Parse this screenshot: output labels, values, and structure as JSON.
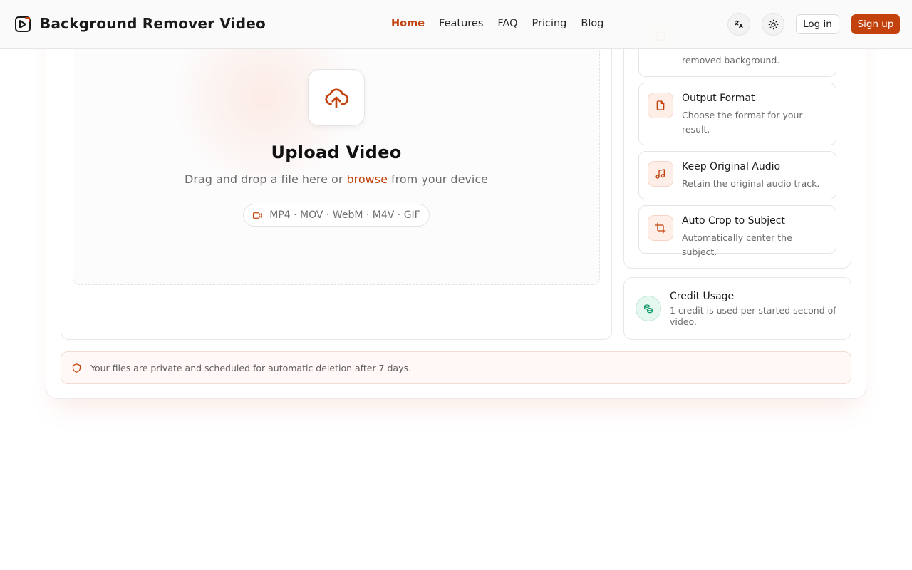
{
  "header": {
    "brand": "Background Remover Video",
    "nav": [
      {
        "label": "Home",
        "active": true
      },
      {
        "label": "Features"
      },
      {
        "label": "FAQ"
      },
      {
        "label": "Pricing"
      },
      {
        "label": "Blog"
      }
    ],
    "login_label": "Log in",
    "signup_label": "Sign up",
    "accent_color": "#c2410c"
  },
  "upload": {
    "title": "Upload Video",
    "subtitle_before": "Drag and drop a file here or ",
    "browse_label": "browse",
    "subtitle_after": " from your device",
    "formats": "MP4 · MOV · WebM · M4V · GIF"
  },
  "options": [
    {
      "icon": "background-icon",
      "title": "",
      "desc": "removed background."
    },
    {
      "icon": "file-icon",
      "title": "Output Format",
      "desc": "Choose the format for your result."
    },
    {
      "icon": "music-icon",
      "title": "Keep Original Audio",
      "desc": "Retain the original audio track."
    },
    {
      "icon": "crop-icon",
      "title": "Auto Crop to Subject",
      "desc": "Automatically center the subject."
    }
  ],
  "credit": {
    "title": "Credit Usage",
    "desc": "1 credit is used per started second of video."
  },
  "privacy": {
    "text": "Your files are private and scheduled for automatic deletion after 7 days."
  }
}
